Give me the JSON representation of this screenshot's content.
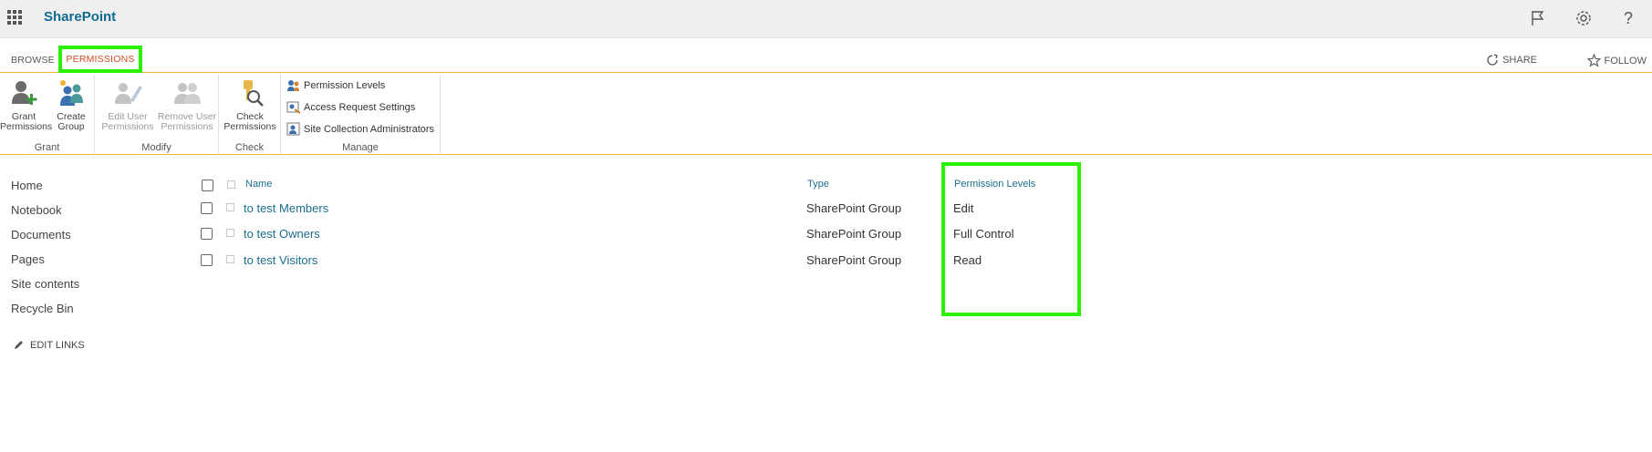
{
  "suite": {
    "brand": "SharePoint",
    "icons": [
      "waffle-icon",
      "flag-icon",
      "gear-icon",
      "help-icon"
    ],
    "help_glyph": "?"
  },
  "tabs": {
    "browse": "BROWSE",
    "permissions": "PERMISSIONS",
    "share": "SHARE",
    "follow": "FOLLOW"
  },
  "ribbon": {
    "grant": {
      "label": "Grant",
      "grant_permissions": [
        "Grant",
        "Permissions"
      ],
      "create_group": [
        "Create",
        "Group"
      ]
    },
    "modify": {
      "label": "Modify",
      "edit_user_permissions": [
        "Edit User",
        "Permissions"
      ],
      "remove_user_permissions": [
        "Remove User",
        "Permissions"
      ]
    },
    "check": {
      "label": "Check",
      "check_permissions": [
        "Check",
        "Permissions"
      ]
    },
    "manage": {
      "label": "Manage",
      "permission_levels": "Permission Levels",
      "access_request_settings": "Access Request Settings",
      "site_collection_administrators": "Site Collection Administrators"
    }
  },
  "leftnav": {
    "items": [
      "Home",
      "Notebook",
      "Documents",
      "Pages",
      "Site contents",
      "Recycle Bin"
    ],
    "edit_links": "EDIT LINKS"
  },
  "table": {
    "headers": {
      "name": "Name",
      "type": "Type",
      "permission_levels": "Permission Levels"
    },
    "rows": [
      {
        "name": "to test Members",
        "type": "SharePoint Group",
        "permission": "Edit"
      },
      {
        "name": "to test Owners",
        "type": "SharePoint Group",
        "permission": "Full Control"
      },
      {
        "name": "to test Visitors",
        "type": "SharePoint Group",
        "permission": "Read"
      }
    ]
  },
  "colors": {
    "brand": "#0f6a8f",
    "active_tab": "#d44820",
    "highlight": "#2bf000",
    "ribbon_rule": "#f2b133",
    "link": "#1b6e8f"
  }
}
